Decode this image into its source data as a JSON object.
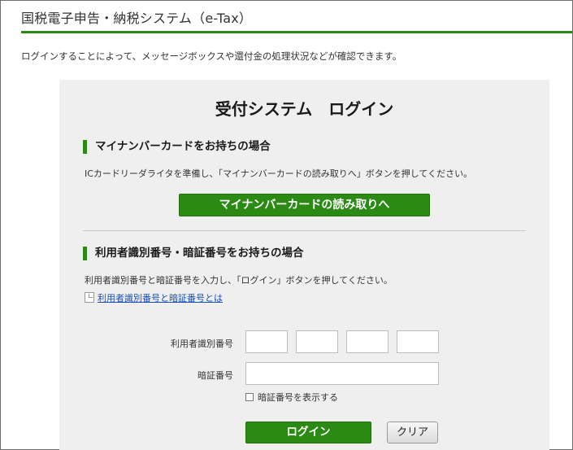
{
  "header": {
    "title": "国税電子申告・納税システム（e-Tax）"
  },
  "intro": "ログインすることによって、メッセージボックスや還付金の処理状況などが確認できます。",
  "panel": {
    "title": "受付システム　ログイン",
    "mynumber": {
      "heading": "マイナンバーカードをお持ちの場合",
      "text": "ICカードリーダライタを準備し、「マイナンバーカードの読み取りへ」ボタンを押してください。",
      "button": "マイナンバーカードの読み取りへ"
    },
    "userid": {
      "heading": "利用者識別番号・暗証番号をお持ちの場合",
      "text": "利用者識別番号と暗証番号を入力し、「ログイン」ボタンを押してください。",
      "link": "利用者識別番号と暗証番号とは",
      "id_label": "利用者識別番号",
      "pin_label": "暗証番号",
      "show_pin_label": "暗証番号を表示する",
      "login_button": "ログイン",
      "clear_button": "クリア"
    }
  },
  "colors": {
    "accent": "#2a8a13",
    "panel_bg": "#efefef",
    "link": "#1a4fb5"
  },
  "icons": {
    "link_icon": "document-icon"
  }
}
